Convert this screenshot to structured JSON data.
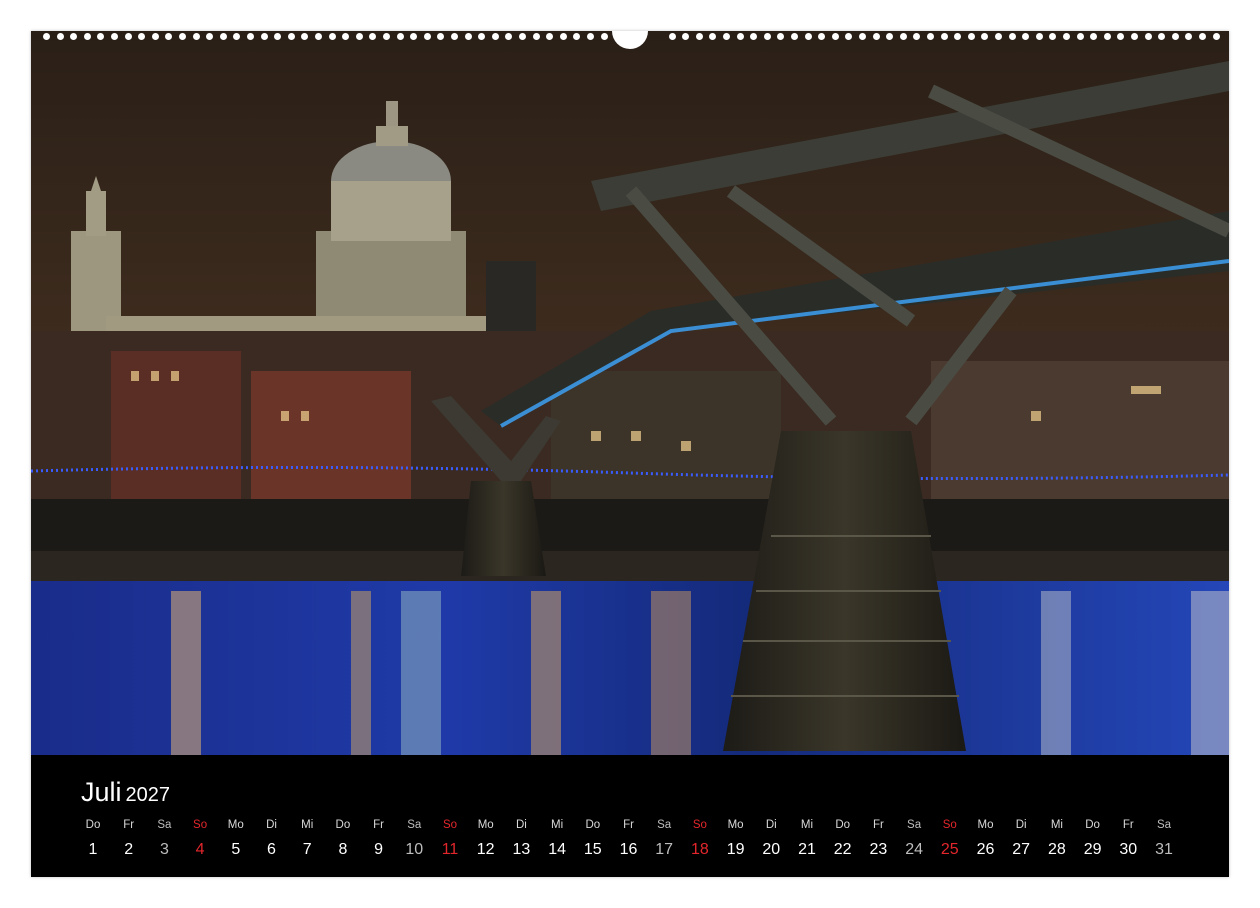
{
  "calendar": {
    "month": "Juli",
    "year": "2027",
    "sunday_color": "#e3262c",
    "days": [
      {
        "wd": "Do",
        "d": "1"
      },
      {
        "wd": "Fr",
        "d": "2"
      },
      {
        "wd": "Sa",
        "d": "3"
      },
      {
        "wd": "So",
        "d": "4"
      },
      {
        "wd": "Mo",
        "d": "5"
      },
      {
        "wd": "Di",
        "d": "6"
      },
      {
        "wd": "Mi",
        "d": "7"
      },
      {
        "wd": "Do",
        "d": "8"
      },
      {
        "wd": "Fr",
        "d": "9"
      },
      {
        "wd": "Sa",
        "d": "10"
      },
      {
        "wd": "So",
        "d": "11"
      },
      {
        "wd": "Mo",
        "d": "12"
      },
      {
        "wd": "Di",
        "d": "13"
      },
      {
        "wd": "Mi",
        "d": "14"
      },
      {
        "wd": "Do",
        "d": "15"
      },
      {
        "wd": "Fr",
        "d": "16"
      },
      {
        "wd": "Sa",
        "d": "17"
      },
      {
        "wd": "So",
        "d": "18"
      },
      {
        "wd": "Mo",
        "d": "19"
      },
      {
        "wd": "Di",
        "d": "20"
      },
      {
        "wd": "Mi",
        "d": "21"
      },
      {
        "wd": "Do",
        "d": "22"
      },
      {
        "wd": "Fr",
        "d": "23"
      },
      {
        "wd": "Sa",
        "d": "24"
      },
      {
        "wd": "So",
        "d": "25"
      },
      {
        "wd": "Mo",
        "d": "26"
      },
      {
        "wd": "Di",
        "d": "27"
      },
      {
        "wd": "Mi",
        "d": "28"
      },
      {
        "wd": "Do",
        "d": "29"
      },
      {
        "wd": "Fr",
        "d": "30"
      },
      {
        "wd": "Sa",
        "d": "31"
      }
    ]
  }
}
